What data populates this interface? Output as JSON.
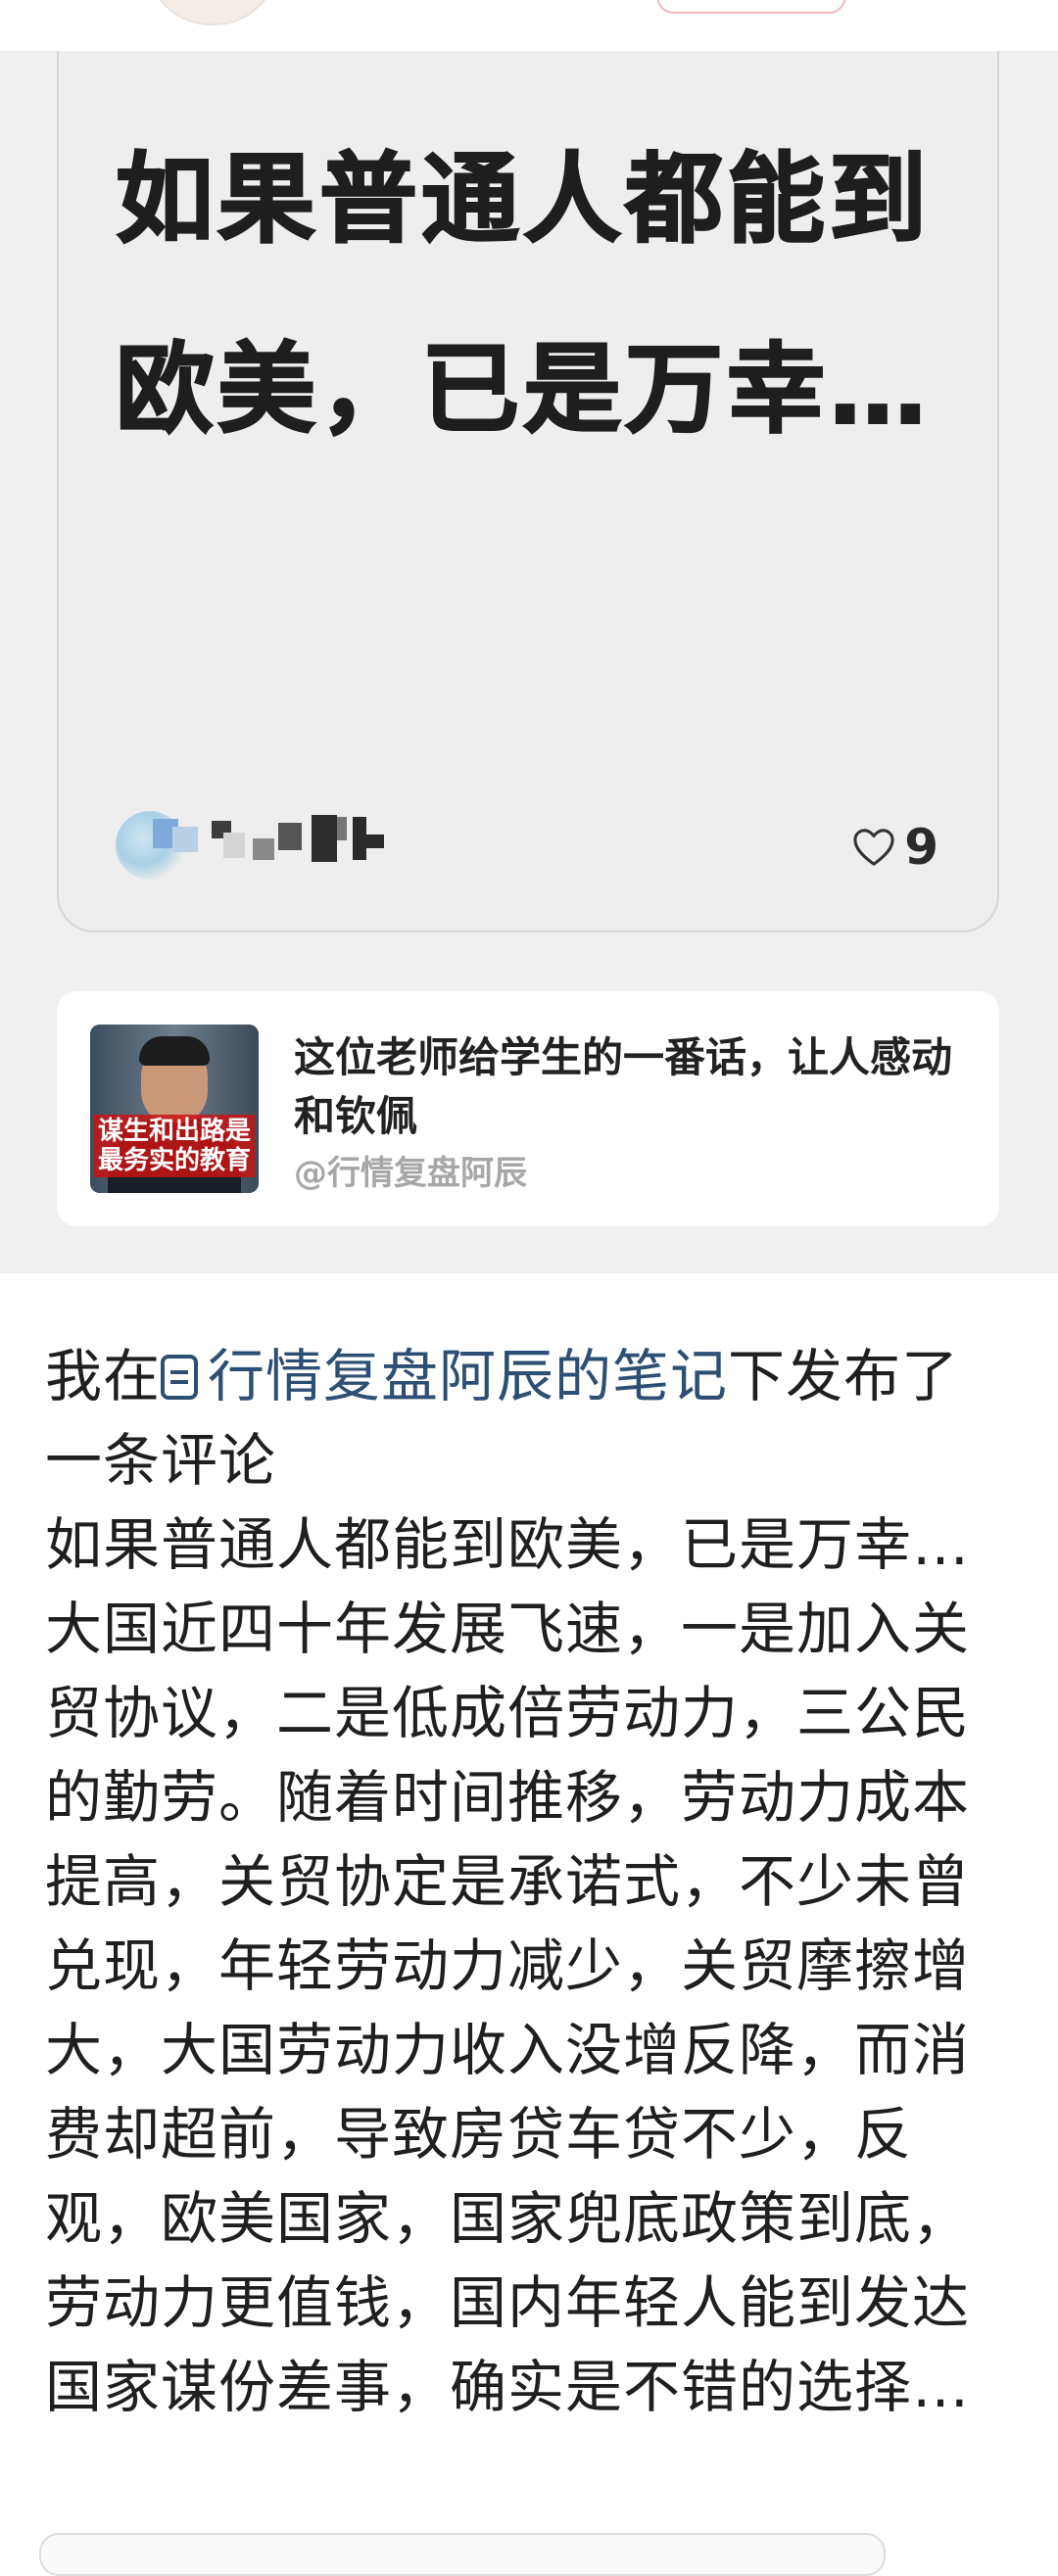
{
  "note_card": {
    "title": "如果普通人都能到欧美，已是万幸…",
    "like_count": "9",
    "like_icon": "heart-outline-icon"
  },
  "ref_card": {
    "title": "这位老师给学生的一番话，让人感动和钦佩",
    "source": "@行情复盘阿辰",
    "thumbnail_caption": "谋生和出路是最务实的教育"
  },
  "comment": {
    "prefix": "我在",
    "note_icon": "note-icon",
    "link_text": "行情复盘阿辰的笔记",
    "suffix": "下发布了一条评论",
    "body": "如果普通人都能到欧美，已是万幸…大国近四十年发展飞速，一是加入关贸协议，二是低成倍劳动力，三公民的勤劳。随着时间推移，劳动力成本提高，关贸协定是承诺式，不少未曾兑现，年轻劳动力减少，关贸摩擦增大，大国劳动力收入没增反降，而消费却超前，导致房贷车贷不少，反观，欧美国家，国家兜底政策到底，劳动力更值钱，国内年轻人能到发达国家谋份差事，确实是不错的选择…"
  }
}
